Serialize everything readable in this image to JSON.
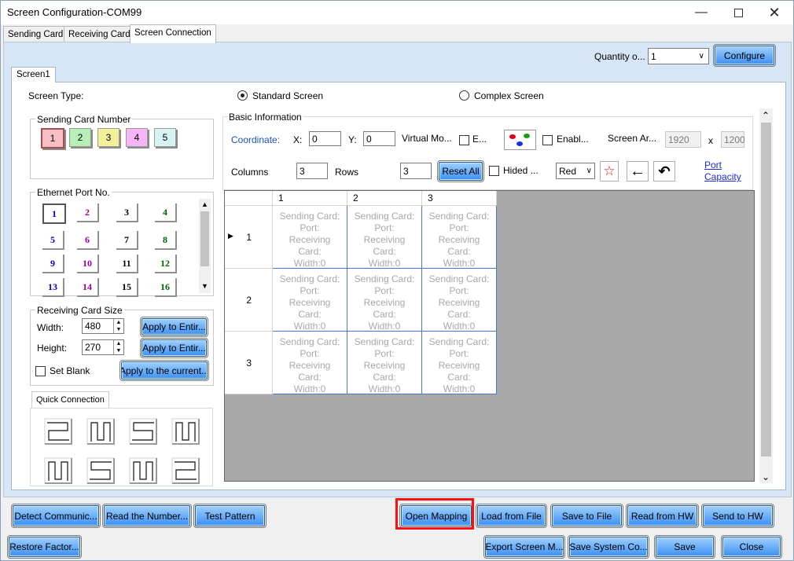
{
  "window": {
    "title": "Screen Configuration-COM99"
  },
  "tabs": [
    "Sending Card",
    "Receiving Card",
    "Screen Connection"
  ],
  "quantity": {
    "label": "Quantity o...",
    "value": "1",
    "configure_label": "Configure"
  },
  "screen_tab": "Screen1",
  "screen_type": {
    "label": "Screen Type:",
    "standard": "Standard Screen",
    "complex": "Complex Screen"
  },
  "sending_card": {
    "title": "Sending Card Number",
    "numbers": [
      "1",
      "2",
      "3",
      "4",
      "5"
    ],
    "colors": [
      "#f7bfc4",
      "#b6f0b6",
      "#f1f199",
      "#f6b6f6",
      "#d8f3f3"
    ]
  },
  "ethernet": {
    "title": "Ethernet Port No.",
    "ports": [
      "1",
      "2",
      "3",
      "4",
      "5",
      "6",
      "7",
      "8",
      "9",
      "10",
      "11",
      "12",
      "13",
      "14",
      "15",
      "16"
    ],
    "colors": [
      "#0000cc",
      "#990099",
      "#000000",
      "#006600",
      "#0000cc",
      "#990099",
      "#000000",
      "#006600",
      "#0000cc",
      "#990099",
      "#000000",
      "#006600",
      "#0000cc",
      "#990099",
      "#000000",
      "#006600"
    ]
  },
  "receiving_size": {
    "title": "Receiving Card Size",
    "width_label": "Width:",
    "width": "480",
    "height_label": "Height:",
    "height": "270",
    "apply_entire_1": "Apply to Entir...",
    "apply_entire_2": "Apply to Entir...",
    "set_blank": "Set Blank",
    "apply_current": "Apply to the current..."
  },
  "quick_connection": {
    "title": "Quick Connection"
  },
  "basic_info": {
    "title": "Basic Information",
    "coordinate": "Coordinate:",
    "x_label": "X:",
    "x": "0",
    "y_label": "Y:",
    "y": "0",
    "virtual": "Virtual Mo...",
    "e_label": "E...",
    "enable_label": "Enabl...",
    "screen_area": "Screen Ar...",
    "area_w": "1920",
    "x_sep": "x",
    "area_h": "1200",
    "columns_label": "Columns",
    "columns": "3",
    "rows_label": "Rows",
    "rows": "3",
    "reset_all": "Reset All",
    "hided": "Hided ...",
    "color_select": "Red",
    "port_capacity_1": "Port",
    "port_capacity_2": "Capacity"
  },
  "grid": {
    "col_headers": [
      "1",
      "2",
      "3"
    ],
    "row_headers": [
      "1",
      "2",
      "3"
    ],
    "cell_text": "Sending Card:\nPort:\nReceiving\nCard:\nWidth:0"
  },
  "bottom_row1": [
    "Detect Communic...",
    "Read the Number...",
    "Test Pattern",
    "Open Mapping",
    "Load from File",
    "Save to File",
    "Read from HW",
    "Send to HW"
  ],
  "bottom_row2": [
    "Restore Factor...",
    "Export Screen M...",
    "Save System Co...",
    "Save",
    "Close"
  ]
}
